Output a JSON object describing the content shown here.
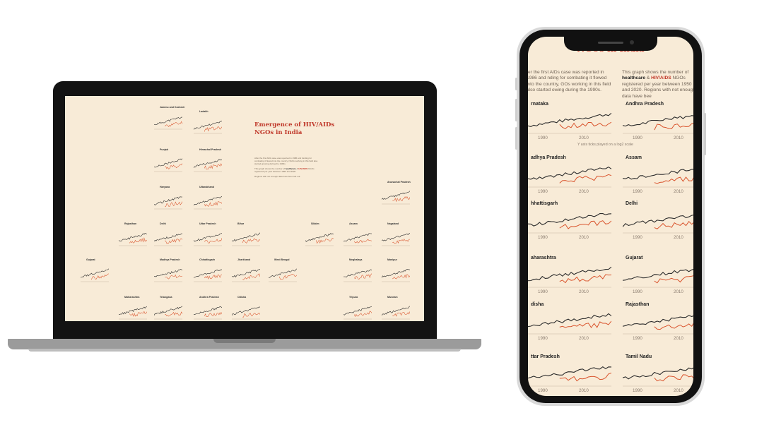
{
  "laptop": {
    "title": "Emergence of HIV/AIDs NGOs in India",
    "intro_p1": "After the first AIDs case was reported in 1986 and funding for combating it flowed into the country, NGOs working in this field also started growing during the 1990s.",
    "intro_p2a": "This graph shows the number of",
    "intro_healthcare": "healthcare",
    "intro_amp": " & ",
    "intro_hiv": "HIV/AIDS",
    "intro_p2b": " NGOs registered per year between 1950 and 2020.",
    "intro_p3": "Regions with not enough data have been left out.",
    "states": [
      {
        "name": "Jammu and Kashmir"
      },
      {
        "name": "Ladakh"
      },
      {
        "name": "Punjab"
      },
      {
        "name": "Himachal Pradesh"
      },
      {
        "name": "Haryana"
      },
      {
        "name": "Uttarakhand"
      },
      {
        "name": "Arunachal Pradesh"
      },
      {
        "name": "Rajasthan"
      },
      {
        "name": "Delhi"
      },
      {
        "name": "Uttar Pradesh"
      },
      {
        "name": "Bihar"
      },
      {
        "name": "Sikkim"
      },
      {
        "name": "Assam"
      },
      {
        "name": "Nagaland"
      },
      {
        "name": "Gujarat"
      },
      {
        "name": "Madhya Pradesh"
      },
      {
        "name": "Chhattisgarh"
      },
      {
        "name": "Jharkhand"
      },
      {
        "name": "West Bengal"
      },
      {
        "name": "Meghalaya"
      },
      {
        "name": "Manipur"
      },
      {
        "name": "Maharashtra"
      },
      {
        "name": "Telangana"
      },
      {
        "name": "Andhra Pradesh"
      },
      {
        "name": "Odisha"
      },
      {
        "name": "Tripura"
      },
      {
        "name": "Mizoram"
      }
    ]
  },
  "phone": {
    "title": "NGOs in India",
    "left_col": "ter the first AIDs case was reported in 1986 and nding for combating it flowed into the country, GOs working in this field also started owing during the 1990s.",
    "right_a": "This graph shows the number of",
    "right_healthcare": "healthcare",
    "right_amp": " & ",
    "right_hiv": "HIV/AIDS",
    "right_b": " NGOs registered per year between 1950 and 2020. Regions with not enough data have bee",
    "note": "Y axis ticks played on a log2 scale",
    "tick_1990": "1990",
    "tick_2010": "2010",
    "states": [
      {
        "name": "rnataka"
      },
      {
        "name": "Andhra Pradesh"
      },
      {
        "name": "adhya Pradesh"
      },
      {
        "name": "Assam"
      },
      {
        "name": "hhattisgarh"
      },
      {
        "name": "Delhi"
      },
      {
        "name": "aharashtra"
      },
      {
        "name": "Gujarat"
      },
      {
        "name": "disha"
      },
      {
        "name": "Rajasthan"
      },
      {
        "name": "ttar Pradesh"
      },
      {
        "name": "Tamil Nadu"
      }
    ]
  },
  "colors": {
    "background": "#f8ebd7",
    "accent": "#c0392b",
    "series_total": "#2b2b2b",
    "series_hiv": "#d9532c"
  }
}
